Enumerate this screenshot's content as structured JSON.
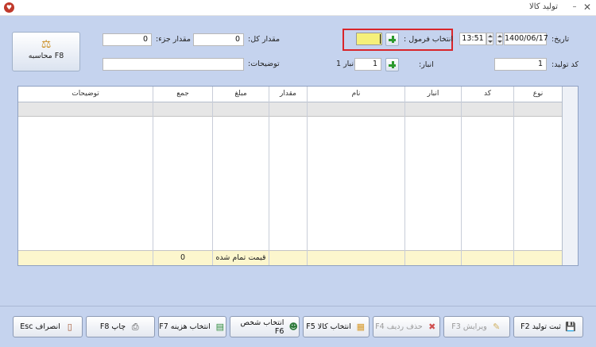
{
  "window": {
    "title": "تولید کالا",
    "minimize": "–",
    "close": "✕"
  },
  "form": {
    "calc_button": "محاسبه F8",
    "total_qty_label": "مقدار کل:",
    "total_qty_value": "0",
    "part_qty_label": "مقدار جزء:",
    "part_qty_value": "0",
    "description_label": "توضیحات:",
    "description_value": "",
    "date_label": "تاریخ:",
    "date_value": "1400/06/17",
    "time_value": "13:51",
    "formula_label": "انتخاب فرمول :",
    "formula_value": "",
    "production_code_label": "کد تولید:",
    "production_code_value": "1",
    "warehouse_label": "انبار:",
    "warehouse_value": "1",
    "warehouse_name": "انبار 1"
  },
  "grid": {
    "columns": [
      "نوع",
      "کد",
      "انبار",
      "نام",
      "مقدار",
      "مبلغ",
      "جمع",
      "توضیحات"
    ],
    "footer": {
      "cost_label": "قیمت تمام شده",
      "total_value": "0"
    }
  },
  "toolbar": {
    "save": "ثبت تولید F2",
    "edit": "ویرایش F3",
    "delete_row": "حذف ردیف F4",
    "select_goods": "انتخاب کالا F5",
    "select_person": "انتخاب شخص F6",
    "select_cost": "انتخاب هزینه F7",
    "print": "چاپ F8",
    "cancel": "انصراف Esc"
  }
}
